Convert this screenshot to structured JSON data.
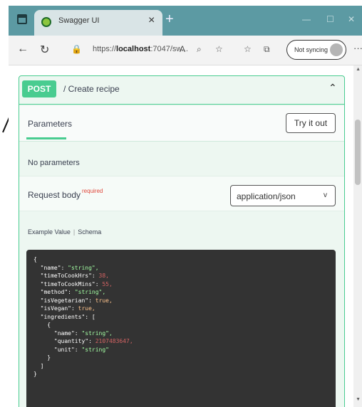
{
  "browser": {
    "tab_title": "Swagger UI",
    "tab_close": "×",
    "new_tab": "+",
    "url_prefix": "https://",
    "url_host": "localhost",
    "url_rest": ":7047/sw...",
    "sync_label": "Not syncing",
    "more": "···"
  },
  "operation": {
    "method": "POST",
    "path": "/  Create recipe",
    "chevron": "⌃"
  },
  "params": {
    "tab_label": "Parameters",
    "try_button": "Try it out",
    "no_params": "No parameters"
  },
  "request_body": {
    "title": "Request body",
    "required": "required",
    "content_type": "application/json",
    "chevron": "v"
  },
  "example": {
    "tab_value": "Example Value",
    "tab_schema": "Schema",
    "json_lines": [
      "{",
      "  \"name\": \"string\",",
      "  \"timeToCookHrs\": 38,",
      "  \"timeToCookMins\": 55,",
      "  \"method\": \"string\",",
      "  \"isVegetarian\": true,",
      "  \"isVegan\": true,",
      "  \"ingredients\": [",
      "    {",
      "      \"name\": \"string\",",
      "      \"quantity\": 2107483647,",
      "      \"unit\": \"string\"",
      "    }",
      "  ]",
      "}"
    ]
  },
  "colors": {
    "post_green": "#49cc90",
    "titlebar": "#5c9aa3",
    "code_bg": "#333333"
  }
}
